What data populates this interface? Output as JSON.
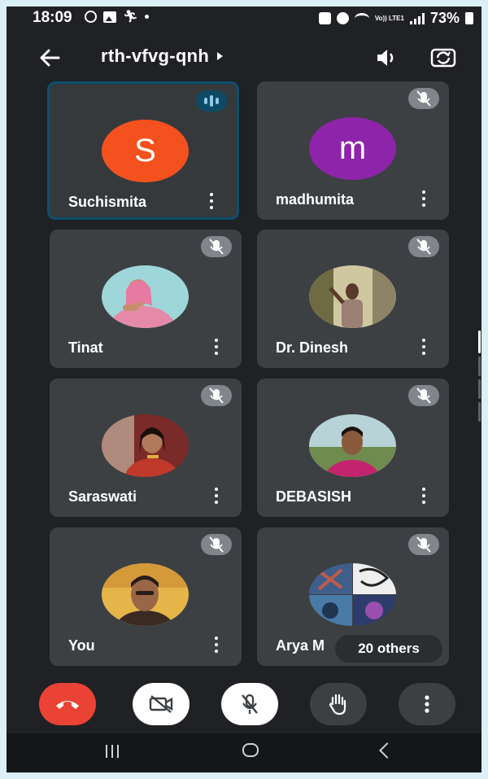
{
  "status_bar": {
    "time": "18:09",
    "network": "Vo)) LTE1",
    "battery": "73%"
  },
  "header": {
    "meeting_code": "rth-vfvg-qnh"
  },
  "participants": [
    {
      "name": "Suchismita",
      "initial": "S",
      "avatar_color": "#f4511e",
      "speaking": true,
      "muted": false
    },
    {
      "name": "madhumita",
      "initial": "m",
      "avatar_color": "#8e24aa",
      "speaking": false,
      "muted": true
    },
    {
      "name": "Tinat",
      "photo": "woman-pink",
      "muted": true
    },
    {
      "name": "Dr. Dinesh",
      "photo": "man-field",
      "muted": true
    },
    {
      "name": "Saraswati",
      "photo": "woman-red",
      "muted": true
    },
    {
      "name": "DEBASISH",
      "photo": "man-outdoor",
      "muted": true
    },
    {
      "name": "You",
      "photo": "man-yellow",
      "muted": true
    },
    {
      "name": "Arya M",
      "photo": "group-collage",
      "muted": true
    }
  ],
  "others_chip": "20 others",
  "controls": {
    "end_call_color": "#ea4335",
    "camera": "off",
    "mic": "muted"
  },
  "colors": {
    "background": "#202124",
    "tile": "#3c4043",
    "active_border": "#0b4f6c"
  }
}
